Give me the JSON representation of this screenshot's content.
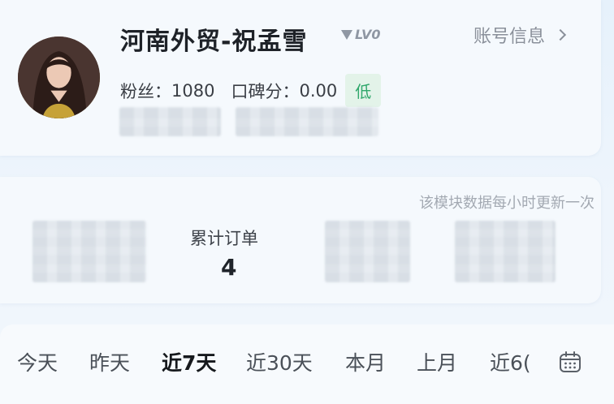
{
  "profile": {
    "name": "河南外贸-祝孟雪",
    "level": "LV0",
    "account_link": "账号信息",
    "fans_label": "粉丝：",
    "fans_value": "1080",
    "rating_label": "口碑分：",
    "rating_value": "0.00",
    "rating_badge": "低"
  },
  "data_panel": {
    "update_note": "该模块数据每小时更新一次",
    "metric_label": "累计订单",
    "metric_value": "4"
  },
  "tabs": [
    {
      "label": "今天",
      "active": false
    },
    {
      "label": "昨天",
      "active": false
    },
    {
      "label": "近7天",
      "active": true
    },
    {
      "label": "近30天",
      "active": false
    },
    {
      "label": "本月",
      "active": false
    },
    {
      "label": "上月",
      "active": false
    },
    {
      "label": "近6(",
      "active": false
    }
  ],
  "icons": {
    "calendar": "calendar-icon",
    "level": "level-triangle-icon",
    "chevron": "chevron-right-icon"
  },
  "colors": {
    "rating_badge_bg": "#e3f3e9",
    "rating_badge_text": "#2fa76b"
  }
}
